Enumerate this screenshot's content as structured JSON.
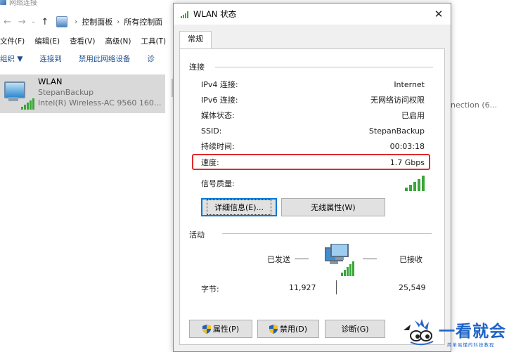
{
  "explorer": {
    "window_title": "网络连接",
    "breadcrumb": [
      "控制面板",
      "所有控制面"
    ],
    "menu": [
      "文件(F)",
      "编辑(E)",
      "查看(V)",
      "高级(N)",
      "工具(T)"
    ],
    "commands": [
      "组织 ▼",
      "连接到",
      "禁用此网络设备",
      "诊"
    ],
    "connection": {
      "name": "WLAN",
      "ssid": "StepanBackup",
      "adapter": "Intel(R) Wireless-AC 9560 160..."
    },
    "other_connection_partial": "nnection (6..."
  },
  "dialog": {
    "title": "WLAN 状态",
    "close_glyph": "✕",
    "tab": "常规",
    "connection_group": "连接",
    "rows": [
      {
        "key": "IPv4 连接:",
        "value": "Internet"
      },
      {
        "key": "IPv6 连接:",
        "value": "无网络访问权限"
      },
      {
        "key": "媒体状态:",
        "value": "已启用"
      },
      {
        "key": "SSID:",
        "value": "StepanBackup"
      },
      {
        "key": "持续时间:",
        "value": "00:03:18"
      },
      {
        "key": "速度:",
        "value": "1.7 Gbps"
      }
    ],
    "signal_label": "信号质量:",
    "signal_bars": 5,
    "details_button": "详细信息(E)...",
    "wireless_props_button": "无线属性(W)",
    "activity_group": "活动",
    "sent_label": "已发送",
    "received_label": "已接收",
    "bytes_label": "字节:",
    "bytes_sent": "11,927",
    "bytes_received": "25,549",
    "properties_button": "属性(P)",
    "disable_button": "禁用(D)",
    "diagnose_button": "诊断(G)"
  },
  "watermark": {
    "brand": "一看就会",
    "slogan": "简单易懂的科技教程"
  },
  "colors": {
    "highlight": "#e02a2a",
    "signal_green": "#3aa63a",
    "brand_blue": "#1e63c7",
    "link_blue": "#1d4e8f"
  }
}
